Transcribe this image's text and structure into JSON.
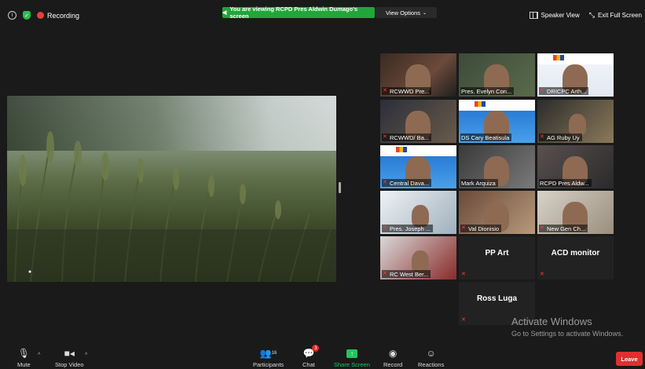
{
  "topbar": {
    "recording_label": "Recording",
    "banner_text": "You are viewing RCPD Pres Aldwin Dumago's screen",
    "view_options_label": "View Options",
    "speaker_view_label": "Speaker View",
    "exit_fullscreen_label": "Exit Full Screen"
  },
  "participants_tiles": [
    {
      "name": "RCWWD Pre...",
      "muted": true
    },
    {
      "name": "Pres. Evelyn Con...",
      "muted": false,
      "active": true
    },
    {
      "name": "DRICPC Arth...",
      "muted": true
    },
    {
      "name": "RCWWD/ Ba...",
      "muted": true
    },
    {
      "name": "DS Cary Beatisula",
      "muted": false
    },
    {
      "name": "AG Ruby Uy",
      "muted": true
    },
    {
      "name": "Central Dava...",
      "muted": true
    },
    {
      "name": "Mark Arquiza",
      "muted": false
    },
    {
      "name": "RCPD Pres Aldw...",
      "muted": false
    },
    {
      "name": "Pres. Joseph ...",
      "muted": true
    },
    {
      "name": "Val Dionisio",
      "muted": true
    },
    {
      "name": "New Gen Ch...",
      "muted": true
    },
    {
      "name": "RC West Ber...",
      "muted": true
    },
    {
      "name": "PP Art",
      "muted": true
    },
    {
      "name": "ACD monitor",
      "muted": true
    },
    {
      "name": "Ross Luga",
      "muted": true
    }
  ],
  "watermark": {
    "line1": "Activate Windows",
    "line2": "Go to Settings to activate Windows."
  },
  "toolbar": {
    "mute_label": "Mute",
    "stop_video_label": "Stop Video",
    "participants_label": "Participants",
    "participants_count": "16",
    "chat_label": "Chat",
    "chat_badge": "3",
    "share_screen_label": "Share Screen",
    "record_label": "Record",
    "reactions_label": "Reactions",
    "leave_label": "Leave"
  },
  "colors": {
    "share_green": "#22a63a",
    "leave_red": "#e02f2f",
    "active_speaker": "#c8e83a",
    "mute_red": "#ff3b3b"
  }
}
